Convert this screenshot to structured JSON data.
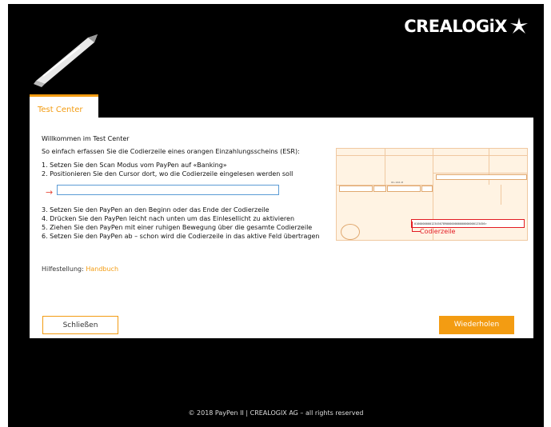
{
  "brand": {
    "name": "CREALOGiX"
  },
  "tab": {
    "label": "Test Center"
  },
  "content": {
    "welcome": "Willkommen im Test Center",
    "intro": "So einfach erfassen Sie die Codierzeile eines orangen Einzahlungsscheins (ESR):",
    "steps_before": [
      "1. Setzen Sie den Scan Modus vom PayPen auf «Banking»",
      "2. Positionieren Sie den Cursor dort, wo die Codierzeile eingelesen werden soll"
    ],
    "input": {
      "value": "",
      "placeholder": ""
    },
    "steps_after": [
      "3. Setzen Sie den PayPen an den Beginn oder das Ende der Codierzeile",
      "4. Drücken Sie den PayPen leicht nach unten um das Einlesellicht zu aktivieren",
      "5. Ziehen Sie den PayPen mit einer ruhigen Bewegung über die gesamte Codierzeile",
      "6. Setzen Sie den PayPen ab – schon wird die Codierzeile in das aktive Feld übertragen"
    ],
    "help_label": "Hilfestellung:",
    "help_link": "Handbuch",
    "image_label": "Codierzeile",
    "slip_code": "010000000012345678900000000000000000123456>",
    "slip_amount": "01•142•8"
  },
  "buttons": {
    "close": "Schließen",
    "repeat": "Wiederholen"
  },
  "footer": "© 2018 PayPen II   |   CREALOGIX AG – all rights reserved",
  "colors": {
    "accent": "#f39c12",
    "highlight": "#e31b23",
    "background": "#000000"
  }
}
